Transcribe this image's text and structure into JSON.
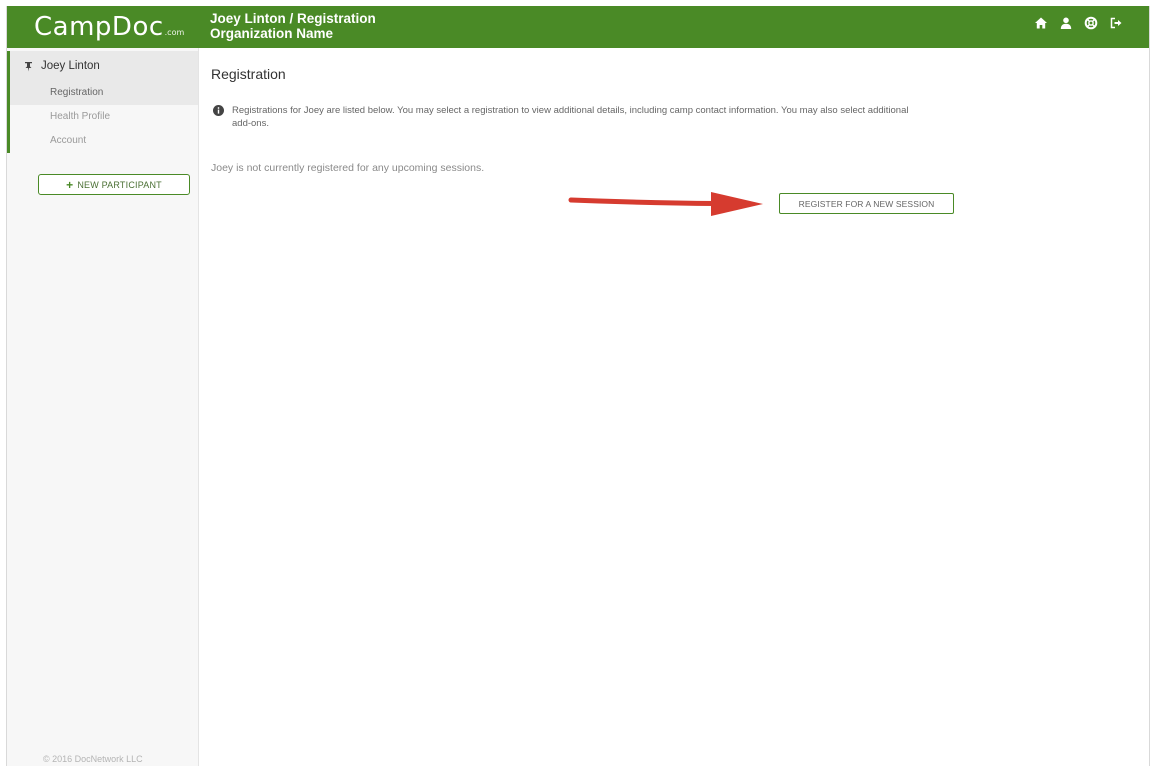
{
  "header": {
    "logo": "CampDoc",
    "logo_suffix": ".com",
    "breadcrumb": "Joey Linton / Registration",
    "organization": "Organization Name",
    "icons": [
      "home-icon",
      "user-icon",
      "help-icon",
      "logout-icon"
    ]
  },
  "sidebar": {
    "participant_name": "Joey Linton",
    "items": [
      {
        "label": "Registration",
        "active": true
      },
      {
        "label": "Health Profile",
        "active": false
      },
      {
        "label": "Account",
        "active": false
      }
    ],
    "new_participant_label": "NEW PARTICIPANT",
    "copyright": "© 2016 DocNetwork LLC"
  },
  "main": {
    "title": "Registration",
    "info": "Registrations for Joey are listed below. You may select a registration to view additional details, including camp contact information. You may also select additional add-ons.",
    "status": "Joey is not currently registered for any upcoming sessions.",
    "register_button": "REGISTER FOR A NEW SESSION"
  },
  "colors": {
    "brand_green": "#4a8a26",
    "arrow_red": "#d63b2f"
  }
}
